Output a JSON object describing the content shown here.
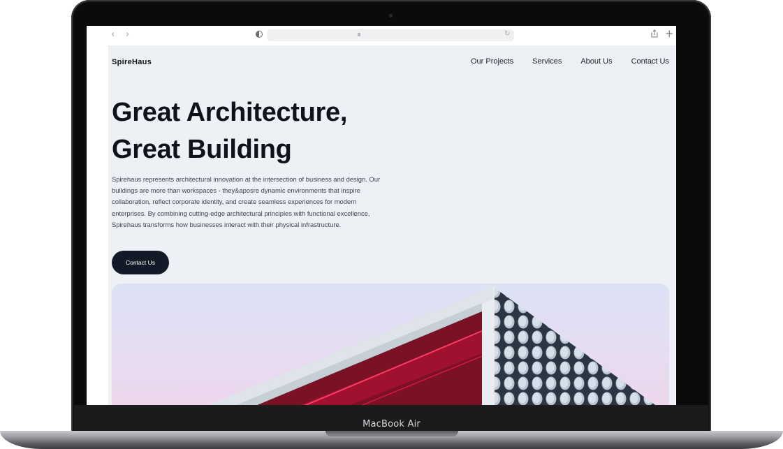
{
  "device": {
    "model_label": "MacBook Air"
  },
  "browser": {
    "back_icon": "chevron-left-icon",
    "forward_icon": "chevron-right-icon",
    "back_glyph": "‹",
    "forward_glyph": "›",
    "address": "",
    "new_tab_glyph": "+"
  },
  "site": {
    "brand": "SpireHaus",
    "nav": [
      "Our Projects",
      "Services",
      "About Us",
      "Contact Us"
    ],
    "hero": {
      "title_line1": "Great Architecture,",
      "title_line2": "Great Building",
      "description": "Spirehaus represents architectural innovation at the intersection of business and design. Our buildings are more than workspaces - they&aposre dynamic environments that inspire collaboration, reflect corporate identity, and create seamless experiences for modern enterprises. By combining cutting-edge architectural principles with functional excellence, Spirehaus transforms how businesses interact with their physical infrastructure.",
      "cta_label": "Contact Us"
    }
  },
  "colors": {
    "page_bg": "#edf0f5",
    "button_bg": "#121a27",
    "accent_red": "#c0103a",
    "building_dark": "#2c3542"
  }
}
